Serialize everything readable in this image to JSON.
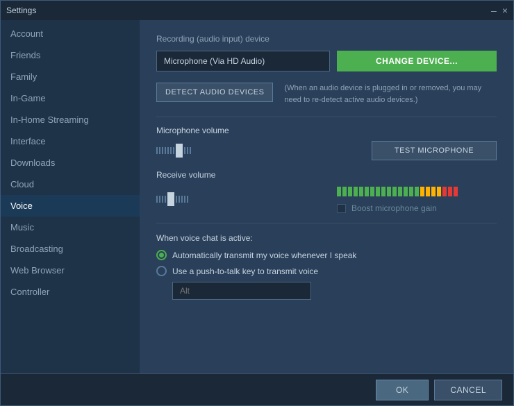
{
  "window": {
    "title": "Settings",
    "close_btn": "×",
    "minimize_btn": "–"
  },
  "sidebar": {
    "items": [
      {
        "id": "account",
        "label": "Account",
        "active": false
      },
      {
        "id": "friends",
        "label": "Friends",
        "active": false
      },
      {
        "id": "family",
        "label": "Family",
        "active": false
      },
      {
        "id": "in-game",
        "label": "In-Game",
        "active": false
      },
      {
        "id": "in-home-streaming",
        "label": "In-Home Streaming",
        "active": false
      },
      {
        "id": "interface",
        "label": "Interface",
        "active": false
      },
      {
        "id": "downloads",
        "label": "Downloads",
        "active": false
      },
      {
        "id": "cloud",
        "label": "Cloud",
        "active": false
      },
      {
        "id": "voice",
        "label": "Voice",
        "active": true
      },
      {
        "id": "music",
        "label": "Music",
        "active": false
      },
      {
        "id": "broadcasting",
        "label": "Broadcasting",
        "active": false
      },
      {
        "id": "web-browser",
        "label": "Web Browser",
        "active": false
      },
      {
        "id": "controller",
        "label": "Controller",
        "active": false
      }
    ]
  },
  "main": {
    "recording_label": "Recording (audio input) device",
    "device_value": "Microphone (Via HD Audio)",
    "change_device_btn": "CHANGE DEVICE...",
    "detect_btn": "DETECT AUDIO DEVICES",
    "detect_note": "(When an audio device is plugged in or removed, you may need to re-detect active audio devices.)",
    "mic_volume_label": "Microphone volume",
    "test_mic_btn": "TEST MICROPHONE",
    "receive_volume_label": "Receive volume",
    "boost_mic_label": "Boost microphone gain",
    "when_voice_active_label": "When voice chat is active:",
    "radio_auto_label": "Automatically transmit my voice whenever I speak",
    "radio_push_label": "Use a push-to-talk key to transmit voice",
    "push_key_placeholder": "Alt"
  },
  "footer": {
    "ok_btn": "OK",
    "cancel_btn": "CANCEL"
  }
}
